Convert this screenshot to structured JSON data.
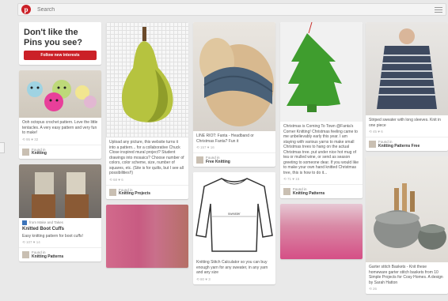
{
  "search": {
    "placeholder": "Search",
    "logo_letter": "p"
  },
  "promo": {
    "title": "Don't like the Pins you see?",
    "button": "Follow new interests"
  },
  "pins": {
    "amigurumi": {
      "desc": "Ooh octopus crochet pattern. Love the little tentacles. A very easy pattern and very fun to make!",
      "stats": "⟲ 95 ♥ 32",
      "found_label": "Found in",
      "board": "Knitting"
    },
    "boot_cuffs": {
      "source": "from Make and Takes",
      "title": "Knitted Boot Cuffs",
      "desc": "Easy knitting pattern for boot cuffs!",
      "stats": "⟲ 107 ♥ 14",
      "found_label": "Found in",
      "board": "Knitting Patterns"
    },
    "pear": {
      "desc": "Upload any picture, this website turns it into a pattern... for a collaborative Chuck Close inspired mural project? Student drawings into mosaics? Choose number of colors, color scheme, size, number of squares, etc. (Site is for quilts, but I see all possibilities!!)",
      "stats": "⟲ 68 ♥ 6",
      "found_label": "Found in",
      "board": "Knitting Projects"
    },
    "headband": {
      "desc": "LINE RIOT: Fanta - Headband or Christmas Fanta? Fun it",
      "stats": "⟲ 157 ♥ 16",
      "found_label": "Found in",
      "board": "Free Knitting"
    },
    "sweater": {
      "desc": "Knitting Stitch Calculator so you can buy enough yarn for any sweater, in any yarn and any size",
      "stats": "⟲ 80 ♥ 3",
      "label": "sweater"
    },
    "tree": {
      "desc": "Christmas is Coming To Town @Fanta's Corner Knitting! Christmas feeling came to me unbelievably early this year. I am staying with various yarns to make small Christmas trees to hang on the actual Christmas tree. put under nice hot mug of tea or mulled wine, or send as season greeting to someone dear. If you would like to make your own hand knitted Christmas tree, this is how to do it...",
      "stats": "⟲ 71 ♥ 15",
      "found_label": "Found in",
      "board": "Knitting Patterns"
    },
    "striped_sweater": {
      "desc": "Striped sweater with long sleeves. Knit in one piece",
      "stats": "⟲ 45 ♥ 6",
      "found_label": "Found in",
      "board": "Knitting Patterns Free"
    },
    "baskets": {
      "desc": "Garter stitch Baskets - Knit these homeware garter stitch baskets from 10 Simple Projects for Cosy Homes. A design by Sarah Hatton",
      "stats": "⟲ 26",
      "found_label": "Found in",
      "board": "Knitting"
    }
  }
}
